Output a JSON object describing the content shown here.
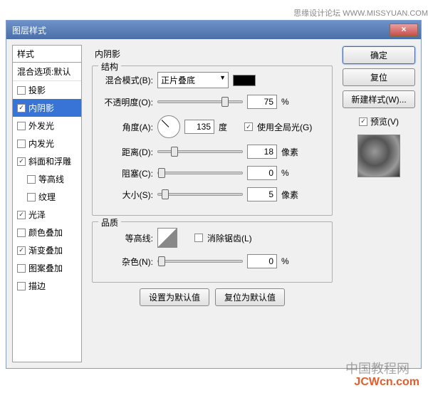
{
  "header": "思缘设计论坛  WWW.MISSYUAN.COM",
  "dialog": {
    "title": "图层样式",
    "close": "×"
  },
  "styles": {
    "header": "样式",
    "blend": "混合选项:默认",
    "items": [
      {
        "label": "投影",
        "checked": false,
        "selected": false,
        "sub": false
      },
      {
        "label": "内阴影",
        "checked": true,
        "selected": true,
        "sub": false
      },
      {
        "label": "外发光",
        "checked": false,
        "selected": false,
        "sub": false
      },
      {
        "label": "内发光",
        "checked": false,
        "selected": false,
        "sub": false
      },
      {
        "label": "斜面和浮雕",
        "checked": true,
        "selected": false,
        "sub": false
      },
      {
        "label": "等高线",
        "checked": false,
        "selected": false,
        "sub": true
      },
      {
        "label": "纹理",
        "checked": false,
        "selected": false,
        "sub": true
      },
      {
        "label": "光泽",
        "checked": true,
        "selected": false,
        "sub": false
      },
      {
        "label": "颜色叠加",
        "checked": false,
        "selected": false,
        "sub": false
      },
      {
        "label": "渐变叠加",
        "checked": true,
        "selected": false,
        "sub": false
      },
      {
        "label": "图案叠加",
        "checked": false,
        "selected": false,
        "sub": false
      },
      {
        "label": "描边",
        "checked": false,
        "selected": false,
        "sub": false
      }
    ]
  },
  "panel": {
    "title": "内阴影",
    "structure": {
      "legend": "结构",
      "blendMode": {
        "label": "混合模式(B):",
        "value": "正片叠底",
        "color": "#000000"
      },
      "opacity": {
        "label": "不透明度(O):",
        "value": "75",
        "unit": "%",
        "pos": 75
      },
      "angle": {
        "label": "角度(A):",
        "value": "135",
        "unit": "度",
        "global": {
          "label": "使用全局光(G)",
          "checked": true
        }
      },
      "distance": {
        "label": "距离(D):",
        "value": "18",
        "unit": "像素",
        "pos": 15
      },
      "choke": {
        "label": "阻塞(C):",
        "value": "0",
        "unit": "%",
        "pos": 0
      },
      "size": {
        "label": "大小(S):",
        "value": "5",
        "unit": "像素",
        "pos": 4
      }
    },
    "quality": {
      "legend": "品质",
      "contour": {
        "label": "等高线:",
        "antialias": {
          "label": "消除锯齿(L)",
          "checked": false
        }
      },
      "noise": {
        "label": "杂色(N):",
        "value": "0",
        "unit": "%",
        "pos": 0
      }
    },
    "buttons": {
      "default": "设置为默认值",
      "reset": "复位为默认值"
    }
  },
  "right": {
    "ok": "确定",
    "cancel": "复位",
    "newStyle": "新建样式(W)...",
    "preview": {
      "label": "预览(V)",
      "checked": true
    }
  },
  "watermark1": "中国教程网",
  "watermark2": "JCWcn.com"
}
